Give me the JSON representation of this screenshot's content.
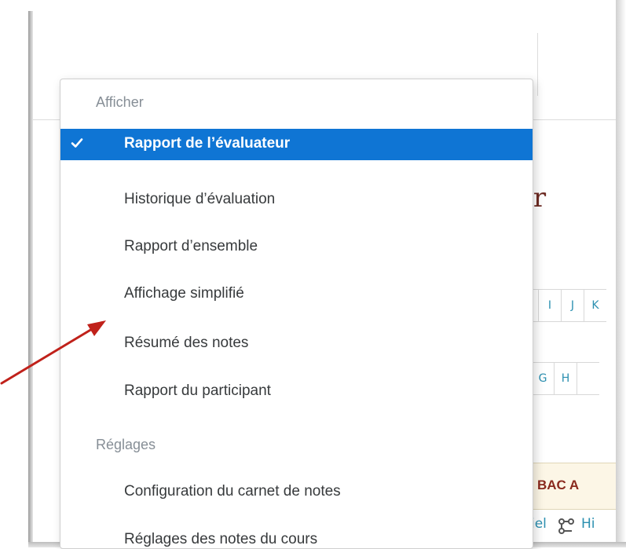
{
  "background": {
    "title_fragment": "ir",
    "letter_row_1": [
      "I",
      "J",
      "K"
    ],
    "letter_row_2": [
      "G",
      "H",
      ""
    ],
    "table_header": "BAC A",
    "table_row": {
      "left_fragment": "iel",
      "link_fragment": "Hi"
    }
  },
  "menu": {
    "sections": [
      {
        "header": "Afficher",
        "items": [
          {
            "label": "Rapport de l’évaluateur",
            "active": true
          },
          {
            "label": "Historique d’évaluation"
          },
          {
            "label": "Rapport d’ensemble"
          },
          {
            "label": "Affichage simplifié"
          },
          {
            "label": "Résumé des notes"
          },
          {
            "label": "Rapport du participant"
          }
        ]
      },
      {
        "header": "Réglages",
        "items": [
          {
            "label": "Configuration du carnet de notes"
          },
          {
            "label": "Réglages des notes du cours"
          }
        ]
      }
    ]
  },
  "icons": {
    "active_item": "checkmark-icon",
    "table_row": "nodes-icon"
  },
  "colors": {
    "active_bg": "#0f75d4",
    "annotation_arrow": "#c0211a",
    "link": "#2a8fb0",
    "heading_accent": "#6d2a22"
  }
}
